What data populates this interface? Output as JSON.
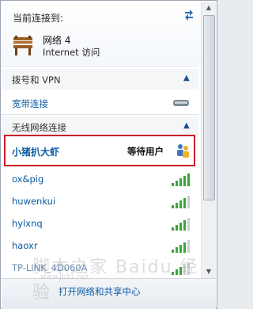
{
  "connected": {
    "title": "当前连接到:",
    "network_name": "网络  4",
    "network_status": "Internet 访问"
  },
  "sections": {
    "dialup_header": "拨号和 VPN",
    "broadband_label": "宽带连接",
    "wireless_header": "无线网络连接"
  },
  "networks": [
    {
      "name": "小猪扒大虾",
      "status": "等待用户",
      "highlighted": true
    },
    {
      "name": "ox&pig",
      "signal": 5
    },
    {
      "name": "huwenkui",
      "signal": 4
    },
    {
      "name": "hylxnq",
      "signal": 4
    },
    {
      "name": "haoxr",
      "signal": 4
    },
    {
      "name": "TP-LINK_4D060A",
      "signal": 3
    }
  ],
  "footer": {
    "link": "打开网络和共享中心"
  },
  "watermark": {
    "text": "脚本之家  Baidu 经验",
    "url": "www.jb51.net"
  },
  "colors": {
    "link": "#0b5aa3",
    "highlight_border": "#c8202a",
    "signal": "#3aa53a"
  },
  "icons": {
    "refresh": "refresh-icon",
    "network": "bench-icon",
    "broadband": "modem-icon",
    "user": "users-icon"
  }
}
